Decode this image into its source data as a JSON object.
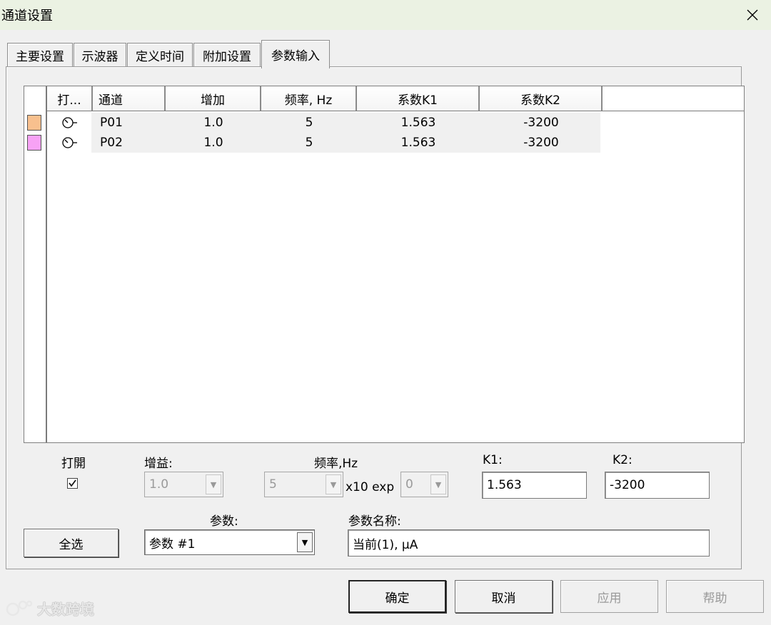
{
  "window": {
    "title": "通道设置",
    "close_glyph": "✕"
  },
  "tabs": [
    {
      "label": "主要设置"
    },
    {
      "label": "示波器"
    },
    {
      "label": "定义时间"
    },
    {
      "label": "附加设置"
    },
    {
      "label": "参数输入",
      "active": true
    }
  ],
  "grid": {
    "columns": [
      "打...",
      "通道",
      "增加",
      "频率, Hz",
      "系数K1",
      "系数K2"
    ],
    "rows": [
      {
        "color": "#f8c08e",
        "icon": "gauge-icon",
        "channel": "P01",
        "gain": "1.0",
        "freq": "5",
        "k1": "1.563",
        "k2": "-3200"
      },
      {
        "color": "#f7a2f5",
        "icon": "gauge-icon",
        "channel": "P02",
        "gain": "1.0",
        "freq": "5",
        "k1": "1.563",
        "k2": "-3200"
      }
    ]
  },
  "form": {
    "open_label": "打開",
    "open_checked": true,
    "gain_label": "增益:",
    "gain_value": "1.0",
    "freq_label": "频率,Hz",
    "freq_value": "5",
    "exp_label": "x10 exp",
    "exp_value": "0",
    "k1_label": "K1:",
    "k1_value": "1.563",
    "k2_label": "K2:",
    "k2_value": "-3200",
    "param_label": "参数:",
    "param_value": "参数 #1",
    "param_name_label": "参数名称:",
    "param_name_value": "当前(1), μA",
    "select_all": "全选"
  },
  "footer": {
    "ok": "确定",
    "cancel": "取消",
    "apply": "应用",
    "help": "帮助"
  },
  "watermark": "大数跨境"
}
